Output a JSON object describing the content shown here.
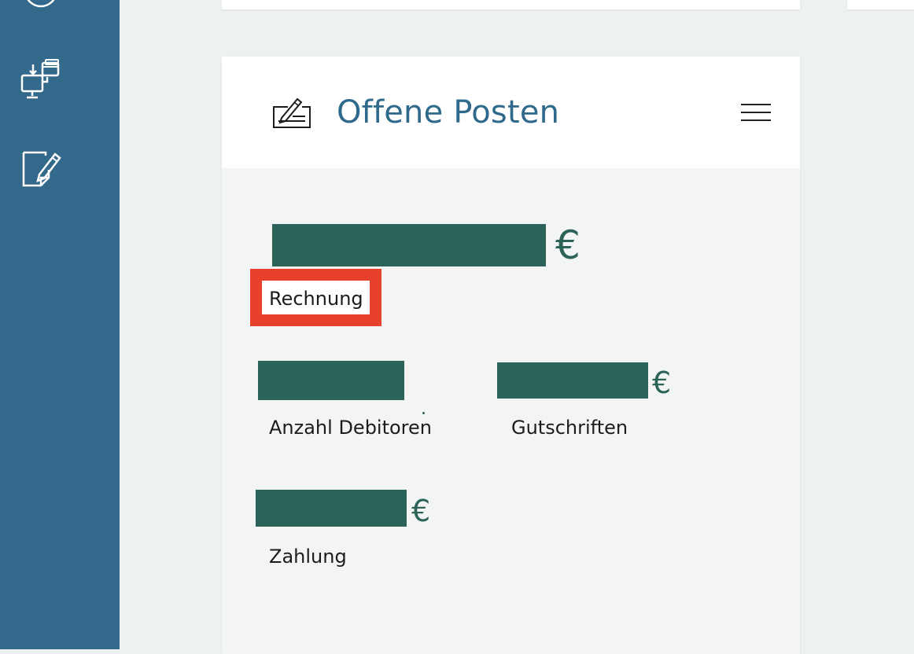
{
  "sidebar": {
    "icons": [
      "clock-icon",
      "monitor-transfer-icon",
      "document-edit-icon"
    ]
  },
  "card": {
    "title": "Offene Posten",
    "header_icon": "cheque-sign-icon",
    "menu_icon": "hamburger-menu-icon"
  },
  "metrics": {
    "rechnung": {
      "currency": "€",
      "label": "Rechnung",
      "value_redacted": true
    },
    "anzahl_debitoren": {
      "label": "Anzahl Debitoren",
      "value_redacted": true
    },
    "gutschriften": {
      "currency": "€",
      "label": "Gutschriften",
      "value_redacted": true
    },
    "zahlung": {
      "currency": "€",
      "label": "Zahlung",
      "value_redacted": true
    }
  },
  "colors": {
    "sidebar": "#336a8c",
    "title": "#2f6a8d",
    "redaction": "#2b6359",
    "highlight": "#e8412b"
  }
}
